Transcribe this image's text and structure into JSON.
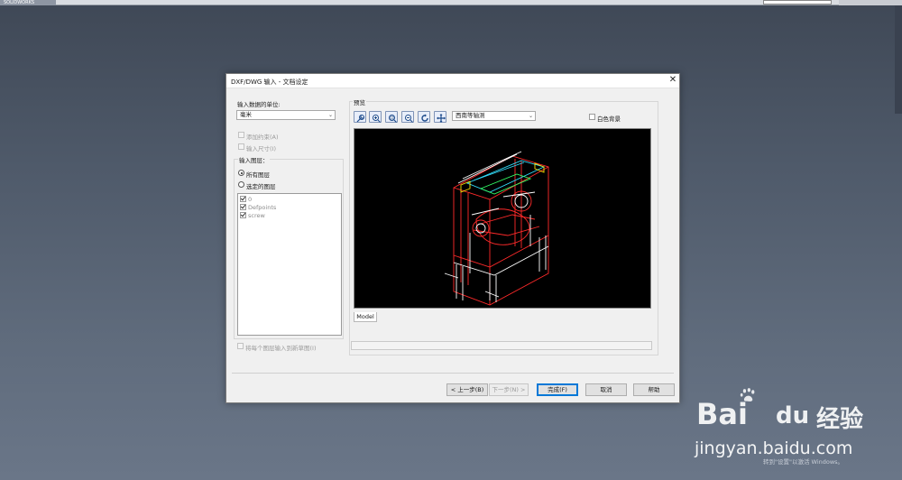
{
  "app": {
    "logo_text": "SOLIDWORKS",
    "colors": {
      "desktop_top": "#3f4856",
      "desktop_bottom": "#6a7688",
      "dialog_bg": "#f0f0f0",
      "accent": "#0078d7"
    }
  },
  "dialog": {
    "title": "DXF/DWG 输入 - 文档设定",
    "close_icon": "close-icon",
    "units": {
      "label": "输入数据的单位:",
      "selected": "毫米"
    },
    "options": {
      "add_constraints": "添加约束(A)",
      "import_dimensions": "输入尺寸(I)"
    },
    "layers": {
      "label": "输入图层：",
      "all_layers": "所有图层",
      "selected_layers": "选定的图层",
      "items": [
        {
          "name": "0",
          "checked": true
        },
        {
          "name": "Defpoints",
          "checked": true
        },
        {
          "name": "screw",
          "checked": true
        }
      ],
      "each_layer_to_sketch": "将每个图层输入到新草图(I)"
    },
    "preview": {
      "label": "预览",
      "view_select": "西南等轴测",
      "white_background": "白色背景",
      "tab_model": "Model",
      "tools": [
        "zoom-fit-icon",
        "zoom-in-icon",
        "zoom-area-icon",
        "zoom-out-icon",
        "rotate-icon",
        "pan-icon"
      ]
    },
    "buttons": {
      "back": "< 上一步(B)",
      "next": "下一步(N) >",
      "finish": "完成(F)",
      "cancel": "取消",
      "help": "帮助"
    }
  },
  "watermark": {
    "brand_a": "Bai",
    "brand_b": "du",
    "brand_c": "经验",
    "url": "jingyan.baidu.com",
    "activate_hint": "转到\"设置\"以激活 Windows。"
  }
}
